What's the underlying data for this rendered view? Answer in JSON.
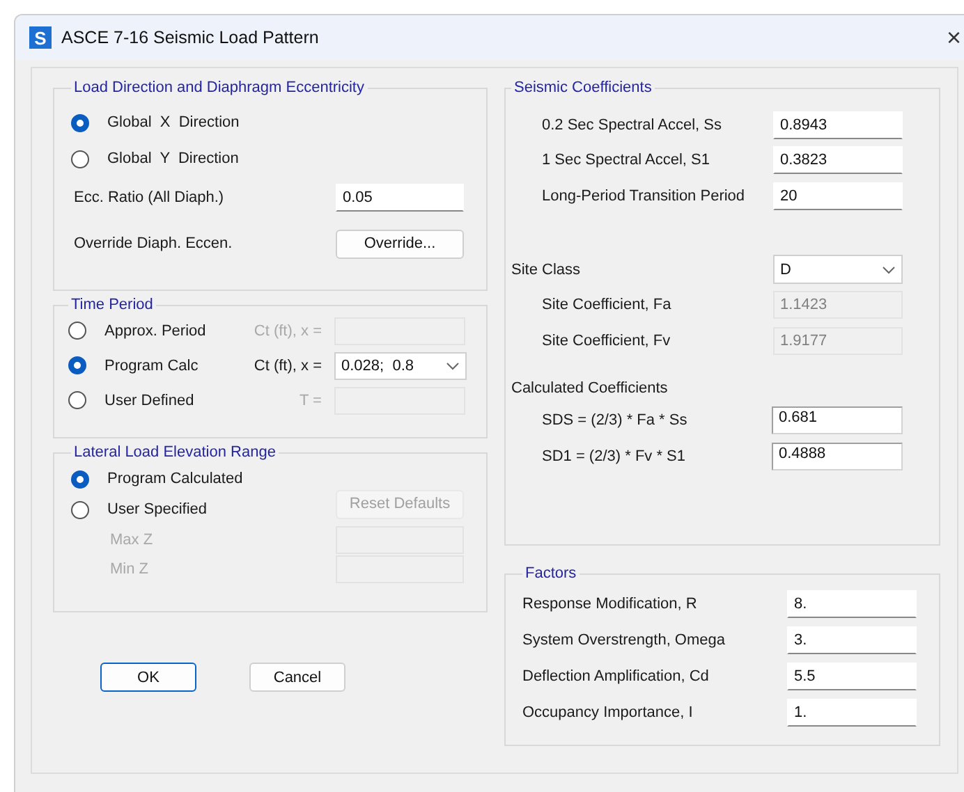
{
  "window": {
    "title": "ASCE 7-16 Seismic Load Pattern",
    "close": "×",
    "icon": "S"
  },
  "load_direction": {
    "title": "Load Direction and Diaphragm Eccentricity",
    "options": [
      {
        "label": "Global  X  Direction",
        "selected": true
      },
      {
        "label": "Global  Y  Direction",
        "selected": false
      }
    ],
    "ecc_ratio": {
      "label": "Ecc. Ratio (All Diaph.)",
      "value": "0.05"
    },
    "override": {
      "label": "Override Diaph. Eccen.",
      "button": "Override..."
    }
  },
  "time_period": {
    "title": "Time Period",
    "rows": [
      {
        "label": "Approx. Period",
        "selected": false,
        "param_label": "Ct (ft), x =",
        "kind": "field",
        "disabled": true
      },
      {
        "label": "Program Calc",
        "selected": true,
        "param_label": "Ct (ft), x =",
        "kind": "dropdown",
        "value": "0.028;  0.8",
        "disabled": false
      },
      {
        "label": "User Defined",
        "selected": false,
        "param_label": "T =",
        "kind": "field",
        "disabled": true
      }
    ]
  },
  "elevation_range": {
    "title": "Lateral Load Elevation Range",
    "options": [
      {
        "label": "Program Calculated",
        "selected": true
      },
      {
        "label": "User Specified",
        "selected": false
      }
    ],
    "reset_button": {
      "label": "Reset Defaults",
      "disabled": true
    },
    "fields": [
      {
        "label": "Max Z",
        "disabled": true
      },
      {
        "label": "Min Z",
        "disabled": true
      }
    ]
  },
  "buttons": [
    {
      "label": "OK",
      "focused": true
    },
    {
      "label": "Cancel",
      "focused": false
    }
  ],
  "seismic_coefficients": {
    "title": "Seismic Coefficients",
    "inputs": [
      {
        "label": "0.2 Sec Spectral Accel, Ss",
        "value": "0.8943"
      },
      {
        "label": "1 Sec Spectral Accel, S1",
        "value": "0.3823"
      },
      {
        "label": "Long-Period Transition Period",
        "value": "20"
      }
    ],
    "site_class": {
      "label": "Site Class",
      "value": "D"
    },
    "site_coefficients": [
      {
        "label": "Site Coefficient, Fa",
        "value": "1.1423"
      },
      {
        "label": "Site Coefficient, Fv",
        "value": "1.9177"
      }
    ],
    "calculated_title": "Calculated Coefficients",
    "calculated": [
      {
        "label": "SDS = (2/3) * Fa * Ss",
        "value": "0.681"
      },
      {
        "label": "SD1 = (2/3) * Fv * S1",
        "value": "0.4888"
      }
    ]
  },
  "factors": {
    "title": "Factors",
    "inputs": [
      {
        "label": "Response Modification, R",
        "value": "8."
      },
      {
        "label": "System Overstrength, Omega",
        "value": "3."
      },
      {
        "label": "Deflection Amplification, Cd",
        "value": "5.5"
      },
      {
        "label": "Occupancy Importance, I",
        "value": "1."
      }
    ]
  }
}
